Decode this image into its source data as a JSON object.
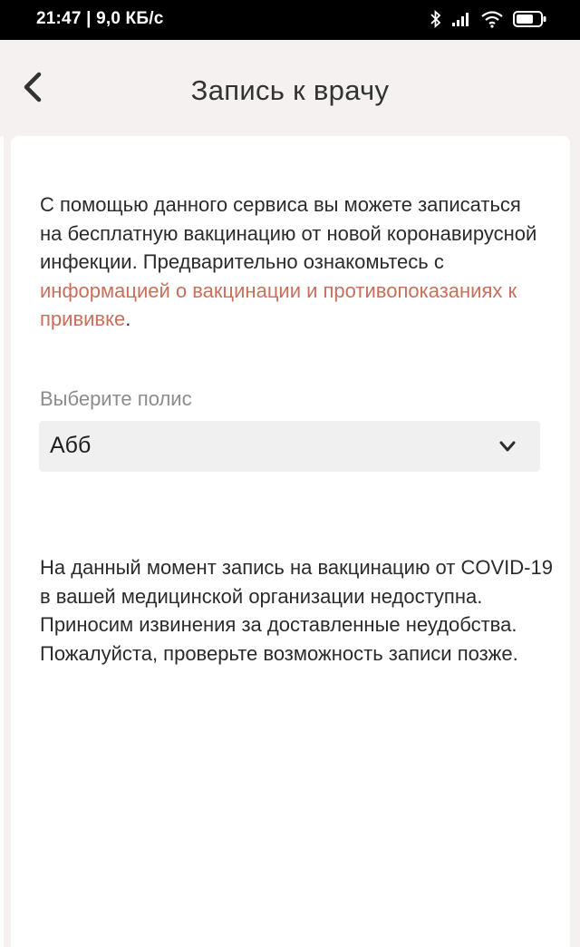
{
  "status_bar": {
    "time": "21:47 | 9,0 КБ/с",
    "icons": [
      "bluetooth-icon",
      "signal-icon",
      "wifi-icon",
      "battery-icon"
    ]
  },
  "header": {
    "title": "Запись к врачу",
    "back_icon": "chevron-left-icon"
  },
  "intro": {
    "text_before": "С помощью данного сервиса вы можете записаться на бесплатную вакцинацию от новой коронавирусной инфекции. Предварительно ознакомьтесь с ",
    "link_text": "информацией о вакцинации и противопоказаниях к прививке",
    "text_after": "."
  },
  "policy": {
    "label": "Выберите полис",
    "selected": "Абб",
    "chevron_icon": "chevron-down-icon"
  },
  "notice": {
    "text": "На данный момент запись на вакцинацию от COVID-19 в вашей медицинской организации недоступна. Приносим извинения за доставленные неудобства. Пожалуйста, проверьте возможность записи позже."
  },
  "colors": {
    "link": "#c8705c",
    "background": "#f4f1f0",
    "card": "#ffffff",
    "select_bg": "#f0f0f0"
  }
}
